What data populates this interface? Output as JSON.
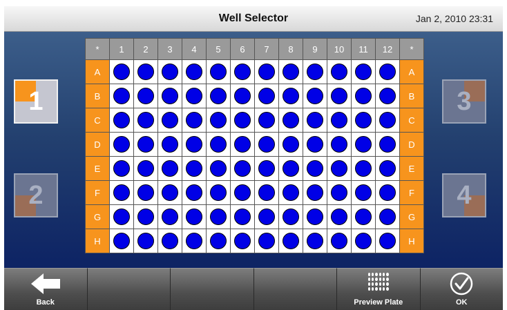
{
  "header": {
    "title": "Well Selector",
    "datetime": "Jan 2, 2010 23:31"
  },
  "plate": {
    "corner_label": "*",
    "columns": [
      "1",
      "2",
      "3",
      "4",
      "5",
      "6",
      "7",
      "8",
      "9",
      "10",
      "11",
      "12"
    ],
    "rows": [
      "A",
      "B",
      "C",
      "D",
      "E",
      "F",
      "G",
      "H"
    ],
    "well_color": "#0000e6",
    "header_color": "#9a9a9a",
    "row_label_color": "#f7941d"
  },
  "quadrants": [
    {
      "label": "1",
      "selected": true
    },
    {
      "label": "2",
      "selected": false
    },
    {
      "label": "3",
      "selected": false
    },
    {
      "label": "4",
      "selected": false
    }
  ],
  "toolbar": {
    "back_label": "Back",
    "back_icon": "left-arrow-icon",
    "preview_label": "Preview Plate",
    "preview_icon": "plate-grid-icon",
    "ok_label": "OK",
    "ok_icon": "checkmark-circle-icon"
  }
}
